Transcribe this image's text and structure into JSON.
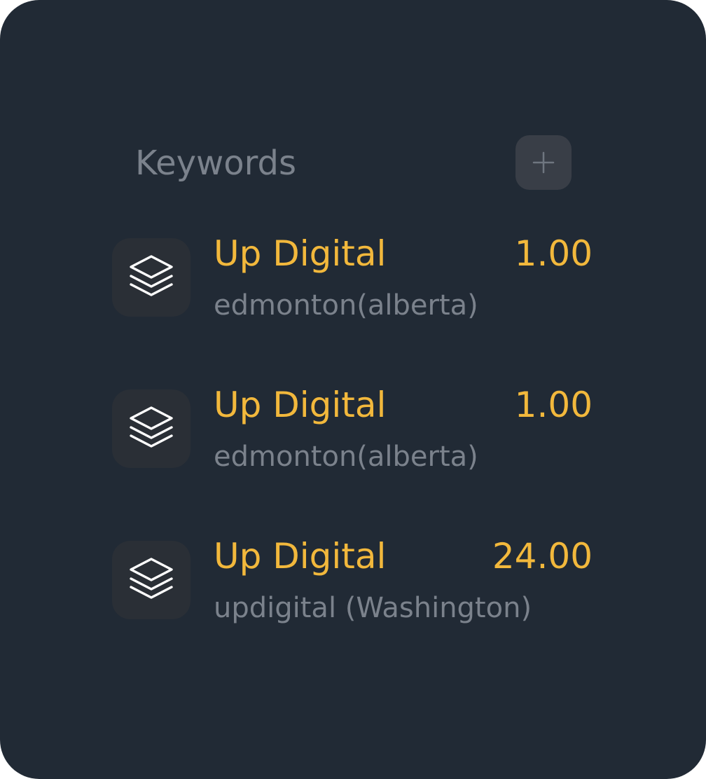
{
  "header": {
    "title": "Keywords",
    "add_icon": "plus-icon"
  },
  "colors": {
    "background": "#212a35",
    "accent": "#f2b83c",
    "muted_text": "#7b828c",
    "icon_box": "#2a2f36",
    "add_button": "#393e47"
  },
  "keywords": [
    {
      "icon": "layers-icon",
      "name": "Up Digital",
      "location": "edmonton(alberta)",
      "value": "1.00"
    },
    {
      "icon": "layers-icon",
      "name": "Up Digital",
      "location": "edmonton(alberta)",
      "value": "1.00"
    },
    {
      "icon": "layers-icon",
      "name": "Up Digital",
      "location": "updigital (Washington)",
      "value": "24.00"
    }
  ]
}
